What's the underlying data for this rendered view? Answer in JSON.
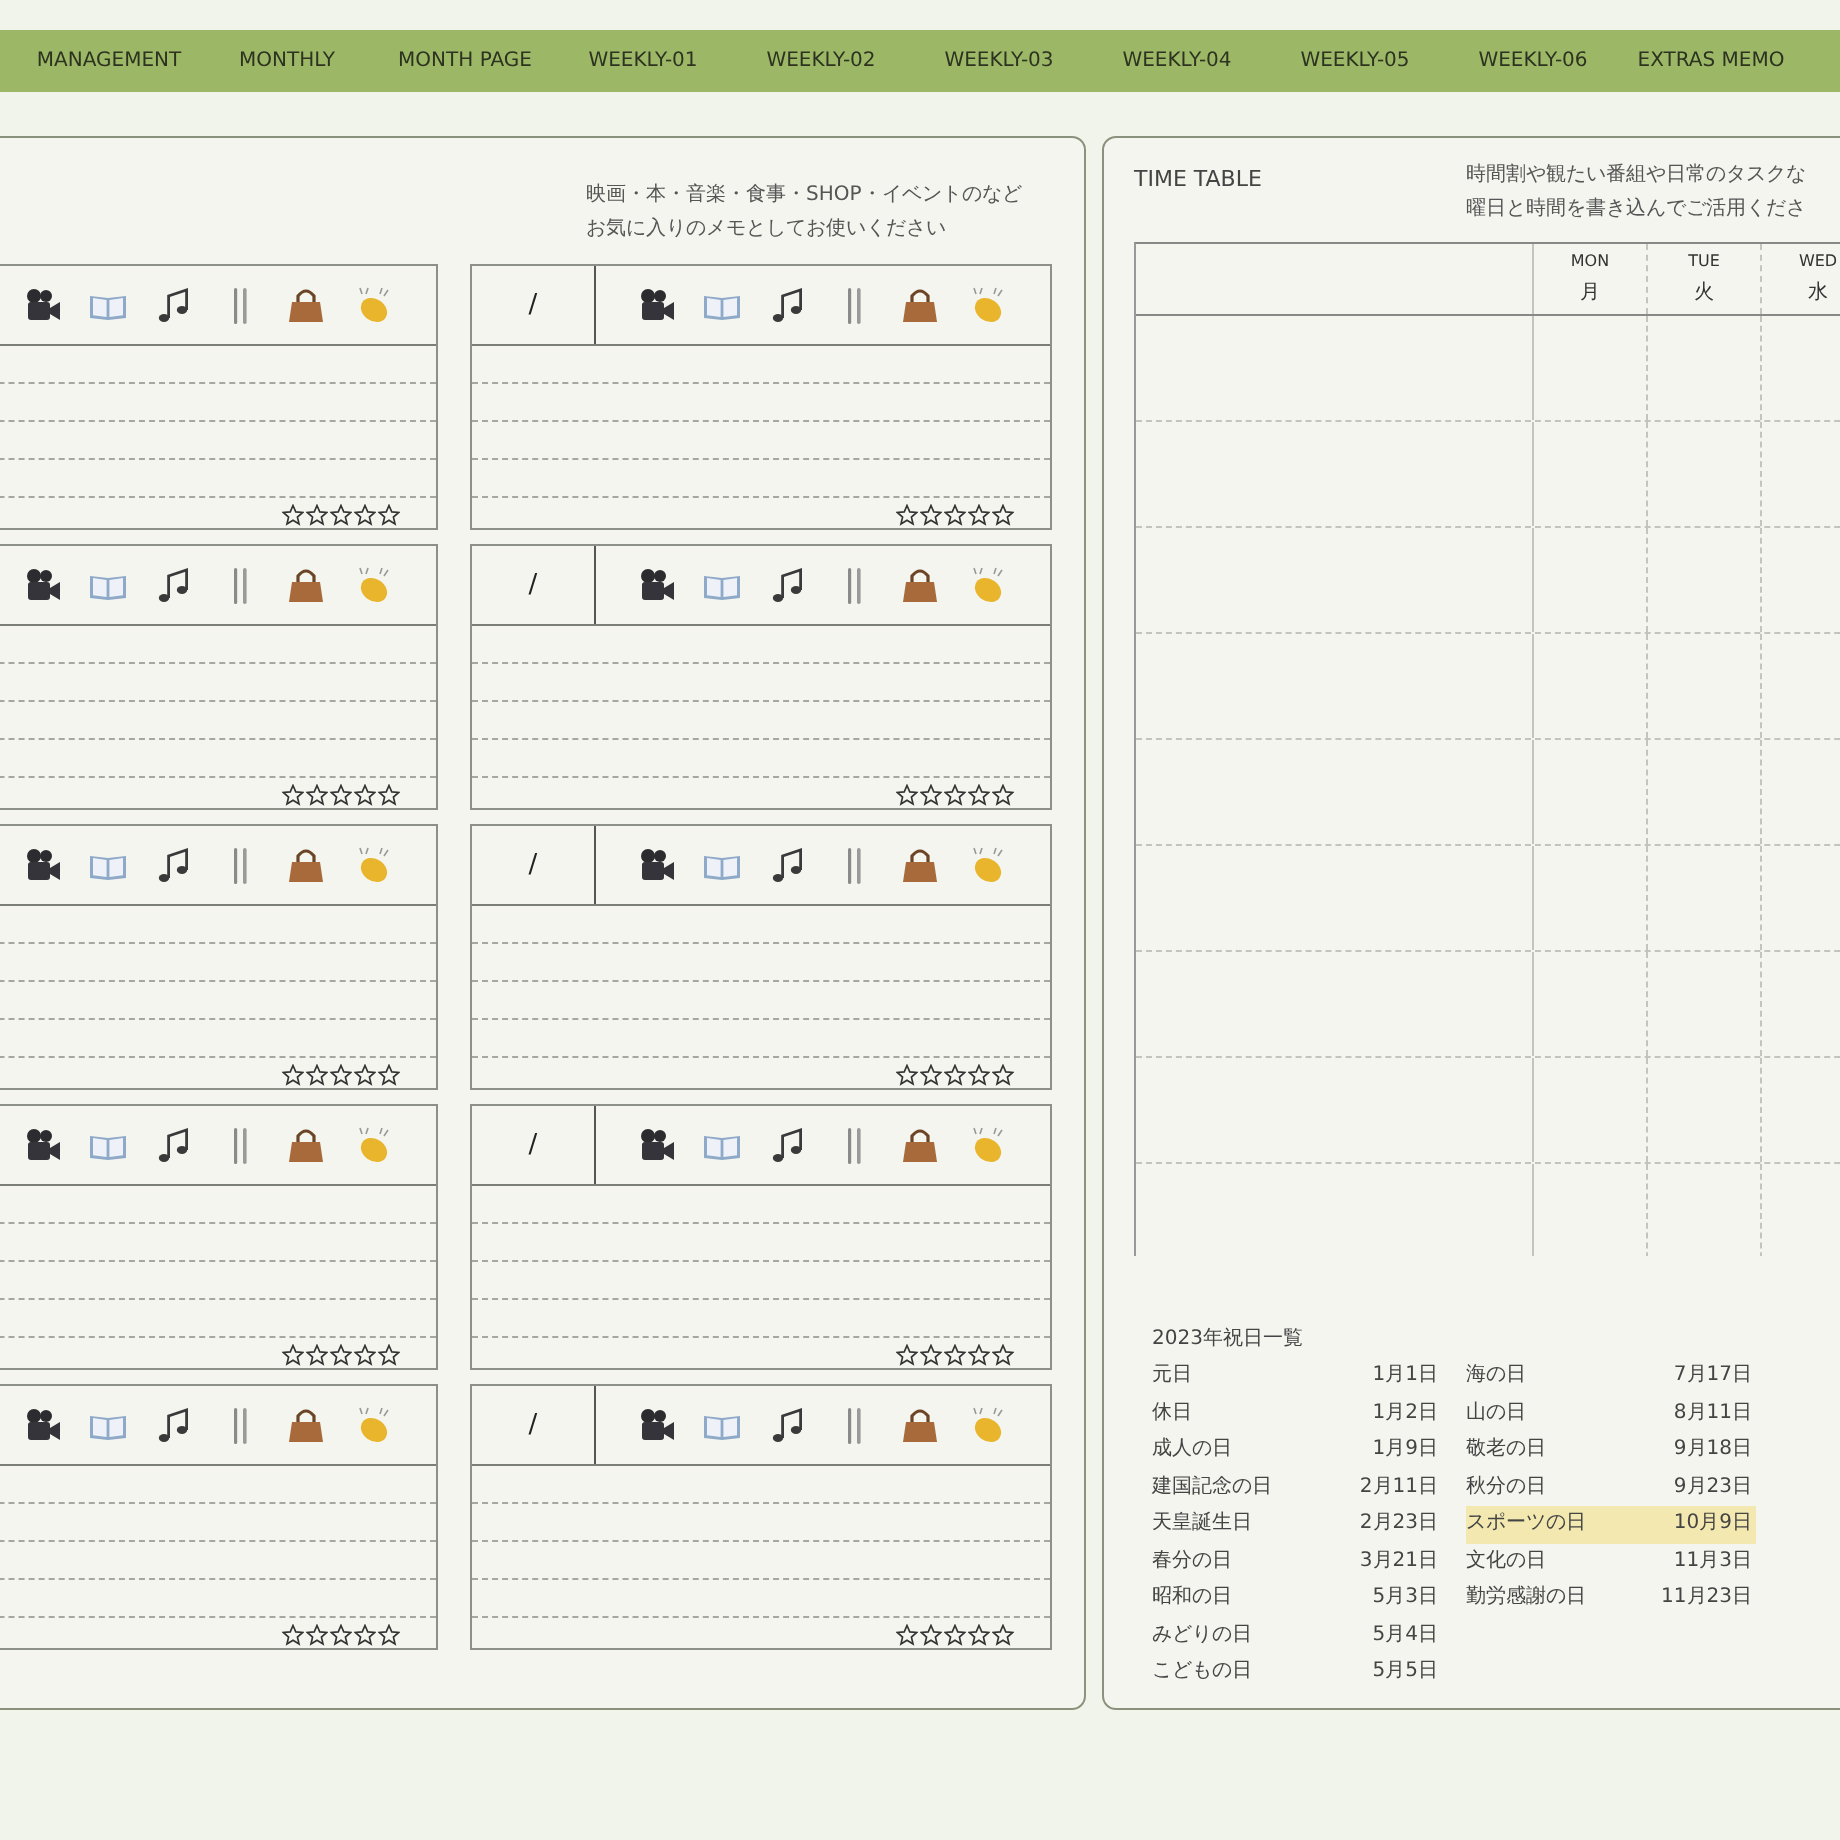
{
  "nav": {
    "tabs": [
      "MANAGEMENT",
      "MONTHLY",
      "MONTH PAGE",
      "WEEKLY-01",
      "WEEKLY-02",
      "WEEKLY-03",
      "WEEKLY-04",
      "WEEKLY-05",
      "WEEKLY-06",
      "EXTRAS MEMO"
    ]
  },
  "memo_panel": {
    "description": [
      "映画・本・音楽・食事・SHOP・イベントのなど",
      "お気に入りのメモとしてお使いください"
    ],
    "cards": [
      {
        "stars": 0
      },
      {
        "date": "/",
        "stars": 0
      },
      {
        "stars": 0
      },
      {
        "date": "/",
        "stars": 0
      },
      {
        "stars": 0
      },
      {
        "date": "/",
        "stars": 0
      },
      {
        "stars": 0
      },
      {
        "date": "/",
        "stars": 0
      },
      {
        "stars": 0
      },
      {
        "date": "/",
        "stars": 0
      }
    ]
  },
  "timetable_panel": {
    "title": "TIME TABLE",
    "description": [
      "時間割や観たい番組や日常のタスクな",
      "曜日と時間を書き込んでご活用くださ"
    ],
    "columns": [
      {
        "en": "MON",
        "ja": "月"
      },
      {
        "en": "TUE",
        "ja": "火"
      },
      {
        "en": "WED",
        "ja": "水"
      }
    ],
    "holidays": {
      "title": "2023年祝日一覧",
      "columns": [
        [
          {
            "name": "元日",
            "date": "1月1日",
            "highlighted": false
          },
          {
            "name": "休日",
            "date": "1月2日",
            "highlighted": false
          },
          {
            "name": "成人の日",
            "date": "1月9日",
            "highlighted": false
          },
          {
            "name": "建国記念の日",
            "date": "2月11日",
            "highlighted": false
          },
          {
            "name": "天皇誕生日",
            "date": "2月23日",
            "highlighted": false
          },
          {
            "name": "春分の日",
            "date": "3月21日",
            "highlighted": false
          },
          {
            "name": "昭和の日",
            "date": "5月3日",
            "highlighted": false
          },
          {
            "name": "みどりの日",
            "date": "5月4日",
            "highlighted": false
          },
          {
            "name": "こどもの日",
            "date": "5月5日",
            "highlighted": false
          }
        ],
        [
          {
            "name": "海の日",
            "date": "7月17日",
            "highlighted": false
          },
          {
            "name": "山の日",
            "date": "8月11日",
            "highlighted": false
          },
          {
            "name": "敬老の日",
            "date": "9月18日",
            "highlighted": false
          },
          {
            "name": "秋分の日",
            "date": "9月23日",
            "highlighted": false
          },
          {
            "name": "スポーツの日",
            "date": "10月9日",
            "highlighted": true
          },
          {
            "name": "文化の日",
            "date": "11月3日",
            "highlighted": false
          },
          {
            "name": "勤労感謝の日",
            "date": "11月23日",
            "highlighted": false
          }
        ]
      ]
    }
  }
}
